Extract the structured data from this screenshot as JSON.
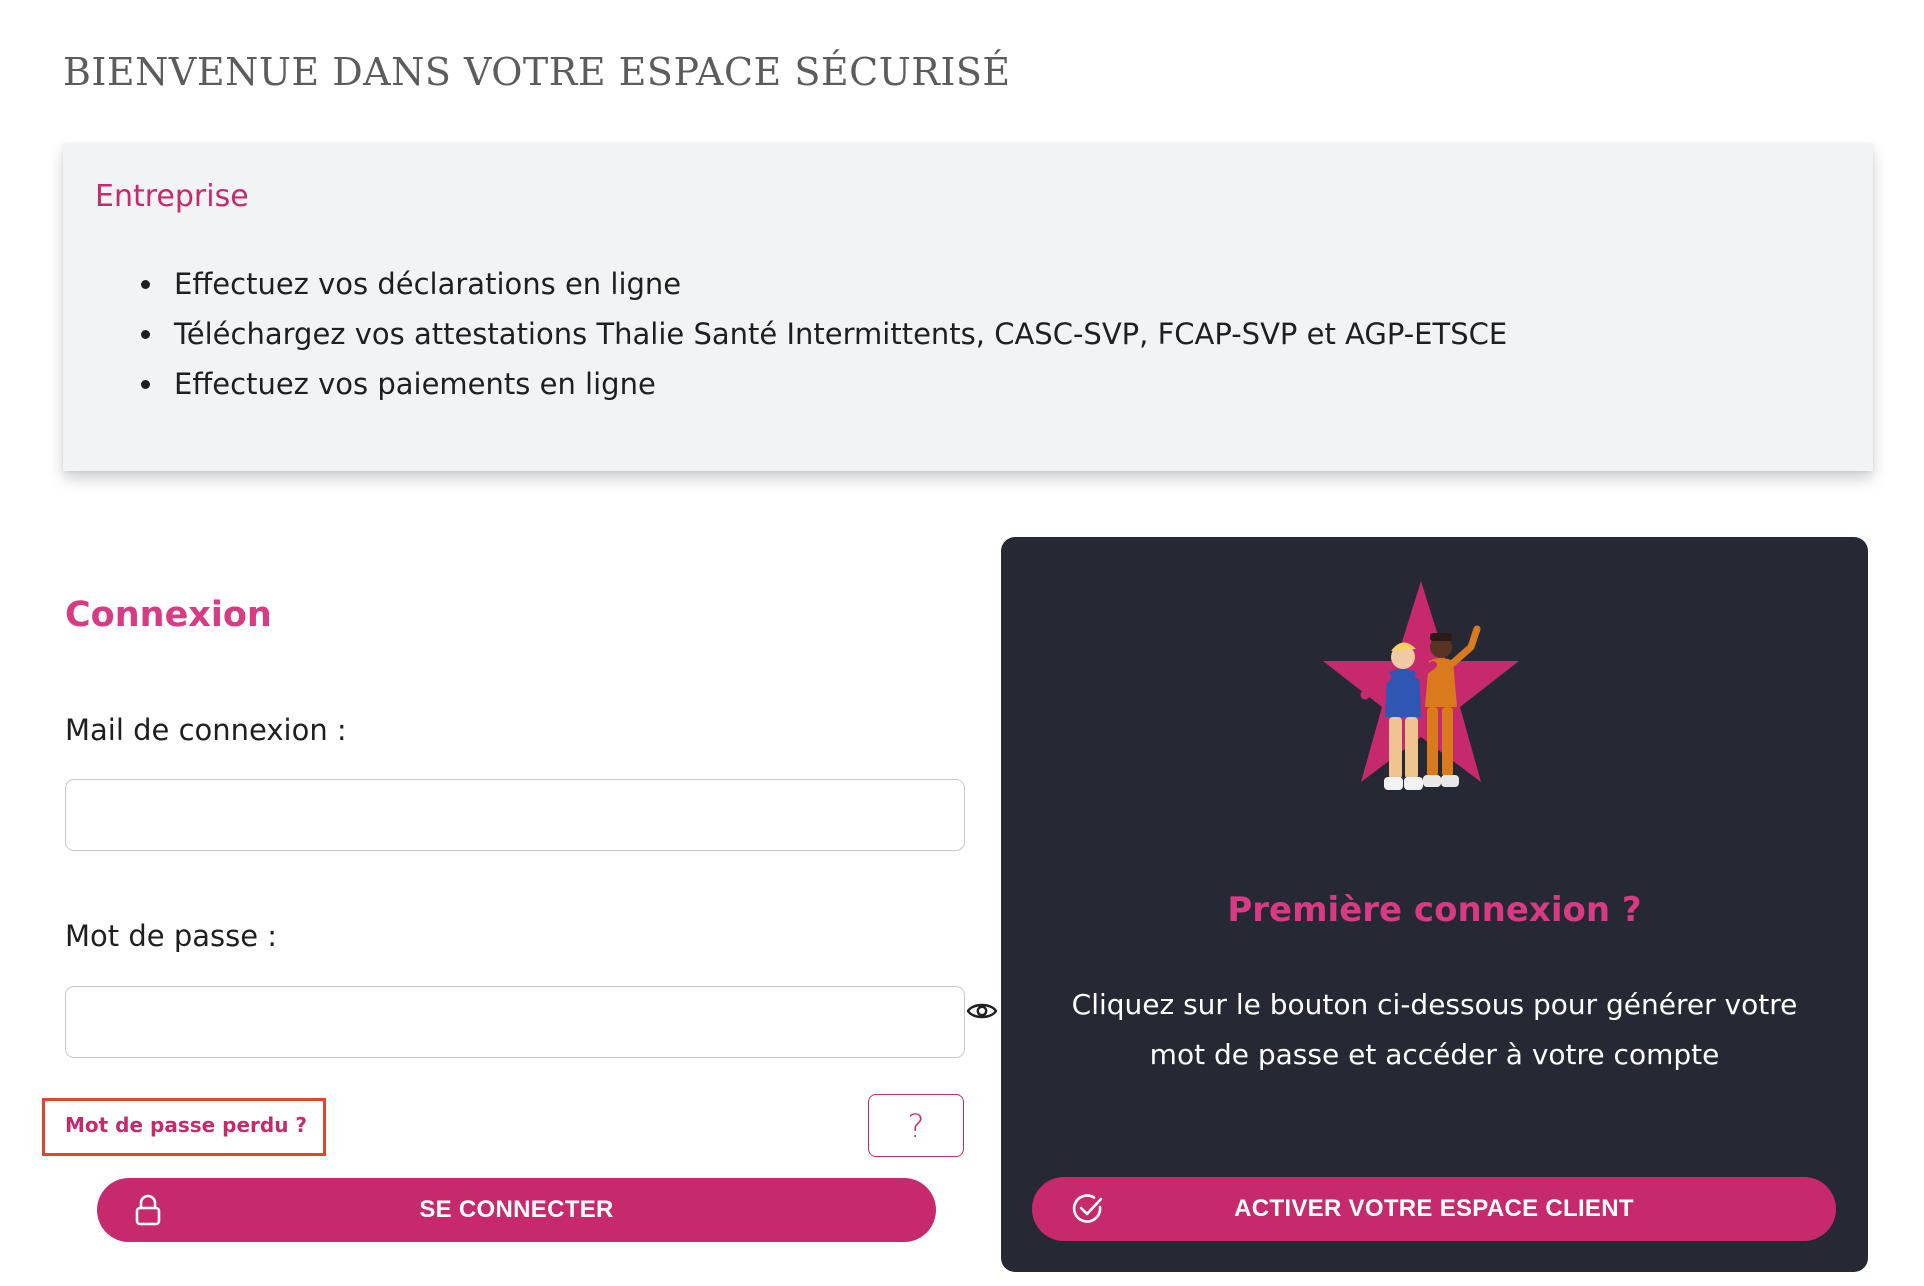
{
  "header": {
    "title": "BIENVENUE DANS VOTRE ESPACE SÉCURISÉ"
  },
  "info_card": {
    "title": "Entreprise",
    "items": [
      "Effectuez vos déclarations en ligne",
      "Téléchargez vos attestations Thalie Santé Intermittents, CASC-SVP, FCAP-SVP et AGP-ETSCE",
      "Effectuez vos paiements en ligne"
    ]
  },
  "login": {
    "title": "Connexion",
    "email_label": "Mail de connexion :",
    "email_value": "",
    "password_label": "Mot de passe :",
    "password_value": "",
    "password_toggle_icon": "eye-icon",
    "lost_password": "Mot de passe perdu ?",
    "help_label": "?",
    "submit_icon": "lock-icon",
    "submit_label": "SE CONNECTER"
  },
  "first_login": {
    "title": "Première connexion ?",
    "text": "Cliquez sur le bouton ci-dessous pour générer votre mot de passe et accéder à votre compte",
    "button_icon": "check-circle-icon",
    "button_label": "ACTIVER VOTRE ESPACE CLIENT"
  },
  "colors": {
    "accent": "#c62a6d",
    "accent_light": "#d83a84",
    "dark_panel": "#262934",
    "info_background": "#f2f3f5",
    "title_gray": "#5c5c5c",
    "highlight_outline": "#e0452e"
  }
}
